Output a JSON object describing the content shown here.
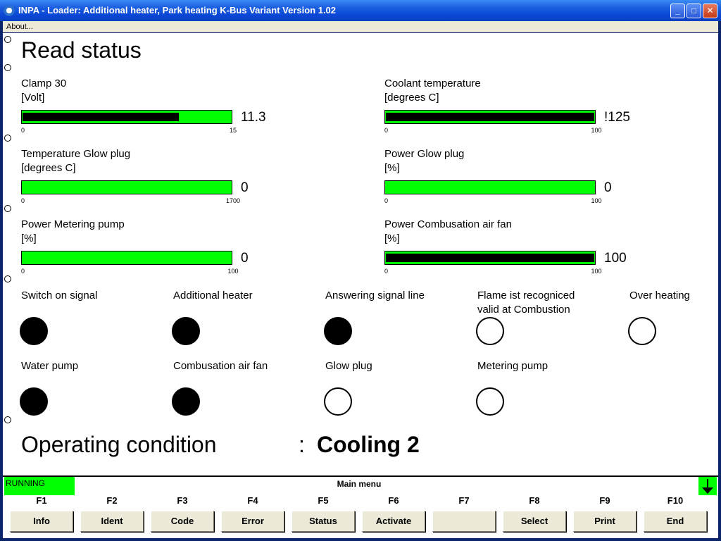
{
  "window": {
    "title": "INPA - Loader:  Additional heater, Park heating K-Bus Variant Version 1.02",
    "min_glyph": "_",
    "max_glyph": "□",
    "close_glyph": "✕"
  },
  "menu": {
    "about": "About..."
  },
  "page": {
    "title": "Read status"
  },
  "gauges": [
    {
      "label": "Clamp 30",
      "unit": "[Volt]",
      "min": "0",
      "max": "15",
      "value": "11.3",
      "fill_fraction": 0.75
    },
    {
      "label": "Coolant temperature",
      "unit": "[degrees C]",
      "min": "0",
      "max": "100",
      "value": "!125",
      "fill_fraction": 1.0
    },
    {
      "label": "Temperature Glow plug",
      "unit": "[degrees C]",
      "min": "0",
      "max": "1700",
      "value": "0",
      "fill_fraction": 0
    },
    {
      "label": "Power Glow plug",
      "unit": "[%]",
      "min": "0",
      "max": "100",
      "value": "0",
      "fill_fraction": 0
    },
    {
      "label": "Power Metering pump",
      "unit": "[%]",
      "min": "0",
      "max": "100",
      "value": "0",
      "fill_fraction": 0
    },
    {
      "label": "Power Combusation air fan",
      "unit": "[%]",
      "min": "0",
      "max": "100",
      "value": "100",
      "fill_fraction": 1.0
    }
  ],
  "lamps": [
    {
      "label": "Switch on signal",
      "on": true
    },
    {
      "label": "Additional heater",
      "on": true
    },
    {
      "label": "Answering signal line",
      "on": true
    },
    {
      "label": "Flame ist recogniced",
      "label2": "valid at Combustion",
      "on": false
    },
    {
      "label": "Over heating",
      "on": false
    },
    {
      "label": "Water pump",
      "on": true
    },
    {
      "label": "Combusation air fan",
      "on": true
    },
    {
      "label": "Glow plug",
      "on": false
    },
    {
      "label": "Metering pump",
      "on": false
    }
  ],
  "operating": {
    "label": "Operating condition",
    "colon": ":",
    "value": "Cooling 2"
  },
  "status": {
    "running": "RUNNING",
    "menu": "Main menu",
    "accent": "#00ff00"
  },
  "fkeys": [
    {
      "key": "F1",
      "label": "Info"
    },
    {
      "key": "F2",
      "label": "Ident"
    },
    {
      "key": "F3",
      "label": "Code"
    },
    {
      "key": "F4",
      "label": "Error"
    },
    {
      "key": "F5",
      "label": "Status"
    },
    {
      "key": "F6",
      "label": "Activate"
    },
    {
      "key": "F7",
      "label": ""
    },
    {
      "key": "F8",
      "label": "Select"
    },
    {
      "key": "F9",
      "label": "Print"
    },
    {
      "key": "F10",
      "label": "End"
    }
  ]
}
